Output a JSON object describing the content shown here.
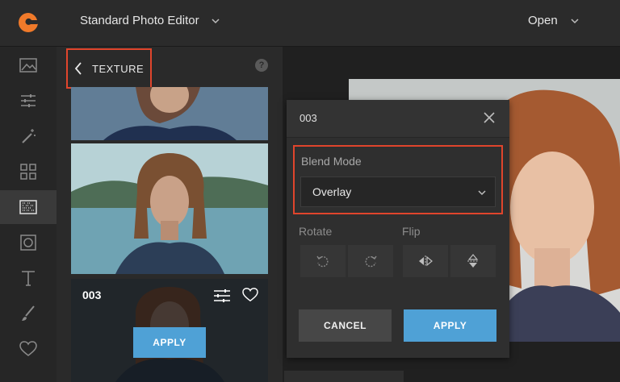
{
  "header": {
    "title": "Standard Photo Editor",
    "open_label": "Open"
  },
  "rail": {
    "items": [
      {
        "icon": "image-icon"
      },
      {
        "icon": "adjust-sliders-icon"
      },
      {
        "icon": "magic-wand-icon"
      },
      {
        "icon": "grid-icon"
      },
      {
        "icon": "texture-icon",
        "active": true
      },
      {
        "icon": "frame-icon"
      },
      {
        "icon": "text-icon"
      },
      {
        "icon": "brush-icon"
      },
      {
        "icon": "heart-icon"
      }
    ]
  },
  "panel": {
    "title": "TEXTURE",
    "help": "?",
    "card": {
      "name": "003",
      "apply_label": "APPLY"
    }
  },
  "dialog": {
    "title": "003",
    "blend_mode_label": "Blend Mode",
    "blend_mode_value": "Overlay",
    "rotate_label": "Rotate",
    "flip_label": "Flip",
    "cancel_label": "CANCEL",
    "apply_label": "APPLY"
  },
  "colors": {
    "accent": "#4fa1d6",
    "highlight": "#e0452c",
    "logo": "#f07a2a"
  }
}
